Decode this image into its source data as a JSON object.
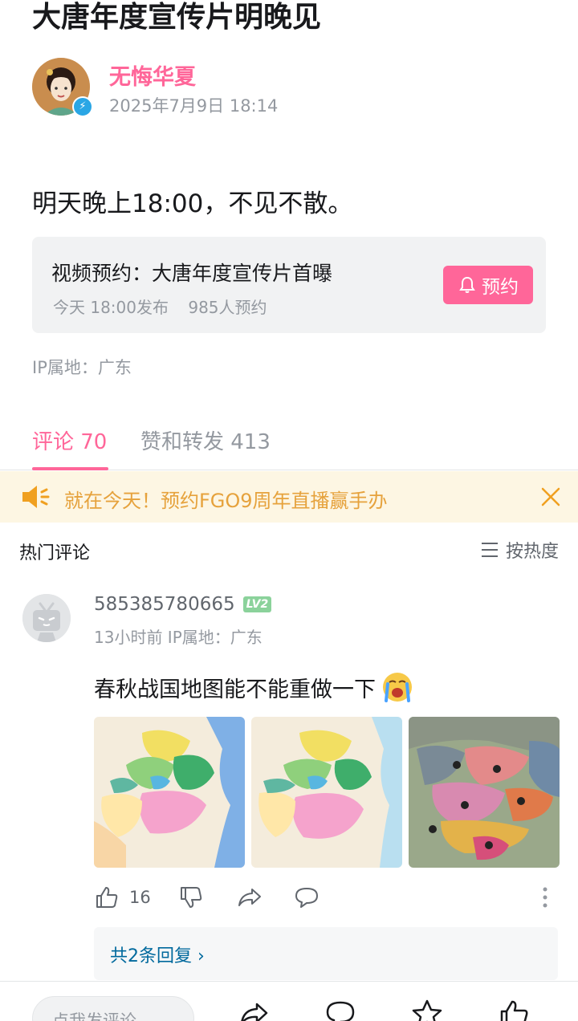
{
  "post": {
    "title": "大唐年度宣传片明晚见",
    "author_name": "无悔华夏",
    "time": "2025年7月9日 18:14",
    "body": "明天晚上18:00，不见不散。",
    "ip_location": "IP属地：广东"
  },
  "reserve_card": {
    "title": "视频预约：大唐年度宣传片首曝",
    "publish": "今天 18:00发布",
    "count": "985人预约",
    "button_label": "预约"
  },
  "tabs": {
    "comments": "评论 70",
    "shares": "赞和转发 413"
  },
  "notice": {
    "text": "就在今天！预约FGO9周年直播赢手办"
  },
  "section": {
    "title": "热门评论",
    "sort_label": "按热度"
  },
  "comment": {
    "user": "585385780665",
    "level": "LV2",
    "meta": "13小时前 IP属地：广东",
    "text": "春秋战国地图能不能重做一下",
    "like_count": "16",
    "replies_link": "共2条回复"
  },
  "bottom": {
    "input_placeholder": "点我发评论"
  },
  "colors": {
    "brand": "#ff6699",
    "notice": "#e6a23c",
    "link": "#00699d"
  }
}
